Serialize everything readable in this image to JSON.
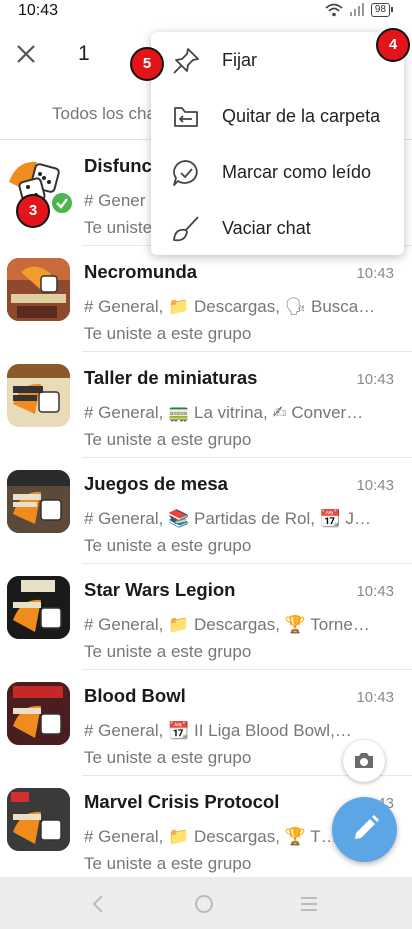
{
  "status_bar": {
    "time": "10:43",
    "battery": "98"
  },
  "header": {
    "selected_count": "1"
  },
  "tabs": {
    "active_label": "Todos los cha"
  },
  "menu": {
    "items": [
      {
        "label": "Fijar",
        "icon": "pin-icon"
      },
      {
        "label": "Quitar de la carpeta",
        "icon": "folder-remove-icon"
      },
      {
        "label": "Marcar como leído",
        "icon": "mark-read-icon"
      },
      {
        "label": "Vaciar chat",
        "icon": "clear-chat-icon"
      }
    ]
  },
  "markers": {
    "m3": "3",
    "m4": "4",
    "m5": "5"
  },
  "chats": [
    {
      "name": "Disfunc",
      "time": "",
      "preview": "# Gener",
      "status": "Te uniste"
    },
    {
      "name": "Necromunda",
      "time": "10:43",
      "preview": "# General, 📁 Descargas, 🗣 Busca…",
      "status": "Te uniste a este grupo"
    },
    {
      "name": "Taller de miniaturas",
      "time": "10:43",
      "preview": "# General, 🚃 La vitrina, ✍ Conver…",
      "status": "Te uniste a este grupo"
    },
    {
      "name": "Juegos de mesa",
      "time": "10:43",
      "preview": "# General, 📚 Partidas de Rol, 📆 J…",
      "status": "Te uniste a este grupo"
    },
    {
      "name": "Star Wars Legion",
      "time": "10:43",
      "preview": "# General, 📁 Descargas, 🏆 Torne…",
      "status": "Te uniste a este grupo"
    },
    {
      "name": "Blood Bowl",
      "time": "10:43",
      "preview": "# General, 📆 II Liga Blood Bowl,…",
      "status": "Te uniste a este grupo"
    },
    {
      "name": "Marvel Crisis Protocol",
      "time": "10:43",
      "preview": "# General, 📁 Descargas, 🏆 T…",
      "status": "Te uniste a este grupo"
    }
  ],
  "colors": {
    "accent": "#5ca6e6",
    "check": "#4cb64c",
    "marker": "#e3141a"
  }
}
